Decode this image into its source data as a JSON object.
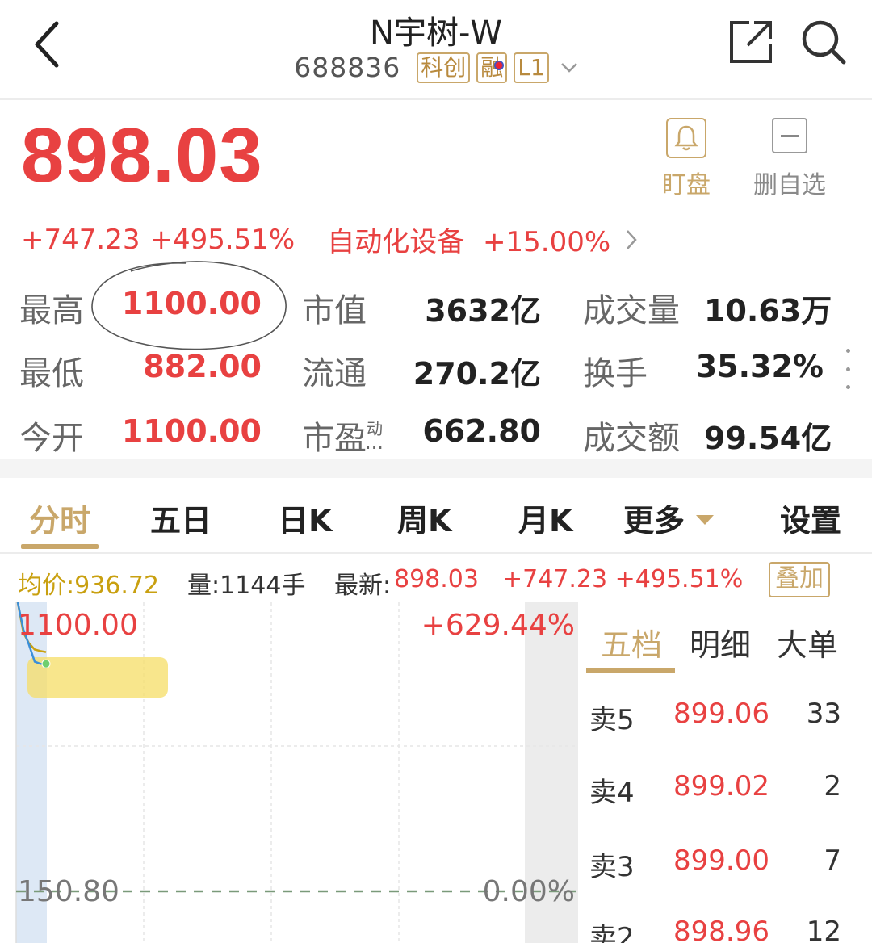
{
  "header": {
    "title": "N宇树-W",
    "code": "688836",
    "tags": [
      "科创",
      "融",
      "L1"
    ]
  },
  "quote": {
    "price": "898.03",
    "change": "+747.23",
    "change_pct": "+495.51%",
    "sector": "自动化设备",
    "sector_change": "+15.00%",
    "alert_label": "盯盘",
    "remove_label": "删自选"
  },
  "stats": {
    "high_label": "最高",
    "high": "1100.00",
    "low_label": "最低",
    "low": "882.00",
    "open_label": "今开",
    "open": "1100.00",
    "mktcap_label": "市值",
    "mktcap": "3632亿",
    "float_label": "流通",
    "float_cap": "270.2亿",
    "pe_label": "市盈",
    "pe_sup": "动",
    "pe_ellipsis": "...",
    "pe": "662.80",
    "volume_label": "成交量",
    "volume": "10.63万",
    "turnover_label": "换手",
    "turnover": "35.32%",
    "amount_label": "成交额",
    "amount": "99.54亿"
  },
  "tabs": [
    "分时",
    "五日",
    "日K",
    "周K",
    "月K",
    "更多",
    "设置"
  ],
  "info": {
    "avg": "均价:936.72",
    "vol": "量:1144手",
    "latest_label": "最新:",
    "latest": "898.03",
    "change": "+747.23 +495.51%",
    "overlay": "叠加"
  },
  "chart": {
    "top_price": "1100.00",
    "top_pct": "+629.44%",
    "base_price": "150.80",
    "base_pct": "0.00%"
  },
  "chart_data": {
    "type": "line",
    "ylim": [
      150.8,
      1100.0
    ],
    "series": [
      {
        "values": [
          1100.0,
          1010.0,
          960.0,
          905.0,
          898.0,
          898.03
        ]
      },
      {
        "values": [
          1100.0,
          1000.0,
          965.0,
          945.0,
          940.0,
          936.72
        ]
      }
    ]
  },
  "book": {
    "tabs": [
      "五档",
      "明细",
      "大单"
    ],
    "rows": [
      {
        "label": "卖5",
        "price": "899.06",
        "vol": "33"
      },
      {
        "label": "卖4",
        "price": "899.02",
        "vol": "2"
      },
      {
        "label": "卖3",
        "price": "899.00",
        "vol": "7"
      },
      {
        "label": "卖2",
        "price": "898.96",
        "vol": "12"
      }
    ]
  },
  "colors": {
    "up": "#e84141",
    "accent": "#c9a76a",
    "avg_line": "#c9a010",
    "price_line": "#3b8fd9"
  }
}
